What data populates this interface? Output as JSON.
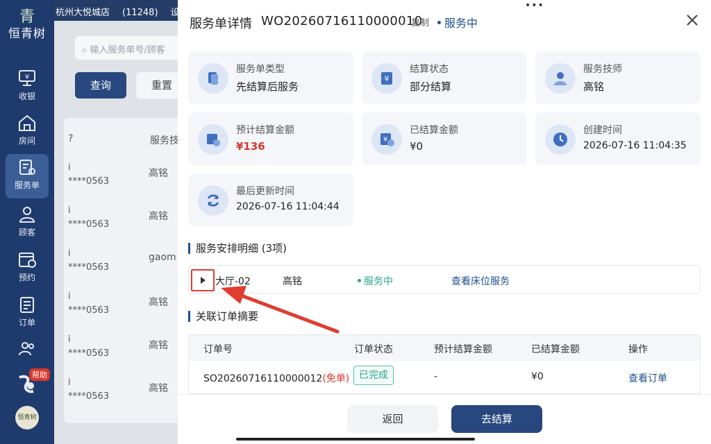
{
  "app": {
    "logo_text": "恒青树",
    "mini_logo_text": "恒青树",
    "store_name": "杭州大悦城店",
    "store_code": "(11248)",
    "topbar_extra": "设"
  },
  "sidebar": {
    "items": [
      {
        "label": "收银",
        "icon": "cashier-monitor-icon"
      },
      {
        "label": "房间",
        "icon": "home-icon"
      },
      {
        "label": "服务单",
        "icon": "service-order-icon",
        "active": true
      },
      {
        "label": "顾客",
        "icon": "user-icon"
      },
      {
        "label": "预约",
        "icon": "calendar-icon"
      },
      {
        "label": "订单",
        "icon": "order-list-icon"
      },
      {
        "label": "",
        "icon": "group-icon"
      }
    ],
    "help_badge": "帮助"
  },
  "background": {
    "search_placeholder": "输入服务单号/顾客",
    "query_btn": "查询",
    "reset_btn": "重置",
    "column_head": "服务技",
    "rows": [
      {
        "a": "i",
        "b": "****0563",
        "c": "高铭"
      },
      {
        "a": "i",
        "b": "****0563",
        "c": "高铭"
      },
      {
        "a": "i",
        "b": "****0563",
        "c": "gaom"
      },
      {
        "a": "i",
        "b": "****0563",
        "c": "高铭"
      },
      {
        "a": "i",
        "b": "****0563",
        "c": "高铭"
      },
      {
        "a": "i",
        "b": "****0563",
        "c": "高铭"
      }
    ]
  },
  "drawer": {
    "grip": "•••",
    "title": "服务单详情",
    "order_no": "WO20260716110000010",
    "copy": "复制",
    "status": "服务中",
    "cards": [
      {
        "label": "服务单类型",
        "value": "先结算后服务",
        "icon": "document-icon"
      },
      {
        "label": "结算状态",
        "value": "部分结算",
        "icon": "yen-receipt-icon"
      },
      {
        "label": "服务技师",
        "value": "高铭",
        "icon": "technician-icon"
      },
      {
        "label": "预计结算金额",
        "value": "¥136",
        "icon": "calendar-clock-icon"
      },
      {
        "label": "已结算金额",
        "value": "¥0",
        "icon": "yen-check-icon"
      },
      {
        "label": "创建时间",
        "value": "2026-07-16 11:04:35",
        "icon": "clock-icon"
      },
      {
        "label": "最后更新时间",
        "value": "2026-07-16 11:04:44",
        "icon": "refresh-icon"
      }
    ],
    "arrangement": {
      "title": "服务安排明细 (3项)",
      "row": {
        "room": "大厅-02",
        "tech": "高铭",
        "status": "服务中",
        "link": "查看床位服务"
      }
    },
    "orders": {
      "title": "关联订单摘要",
      "headers": [
        "订单号",
        "订单状态",
        "预计结算金额",
        "已结算金额",
        "操作"
      ],
      "row": {
        "order_no": "SO20260716110000012",
        "tag": "(免单)",
        "status": "已完成",
        "estimated": "-",
        "settled": "¥0",
        "action": "查看订单"
      }
    },
    "footer": {
      "back": "返回",
      "pay": "去结算"
    }
  },
  "colors": {
    "nav_bg": "#1f3b6e",
    "primary": "#27477e",
    "accent_blue": "#1f4f8f",
    "green": "#2aa58c",
    "red": "#d9362b"
  }
}
